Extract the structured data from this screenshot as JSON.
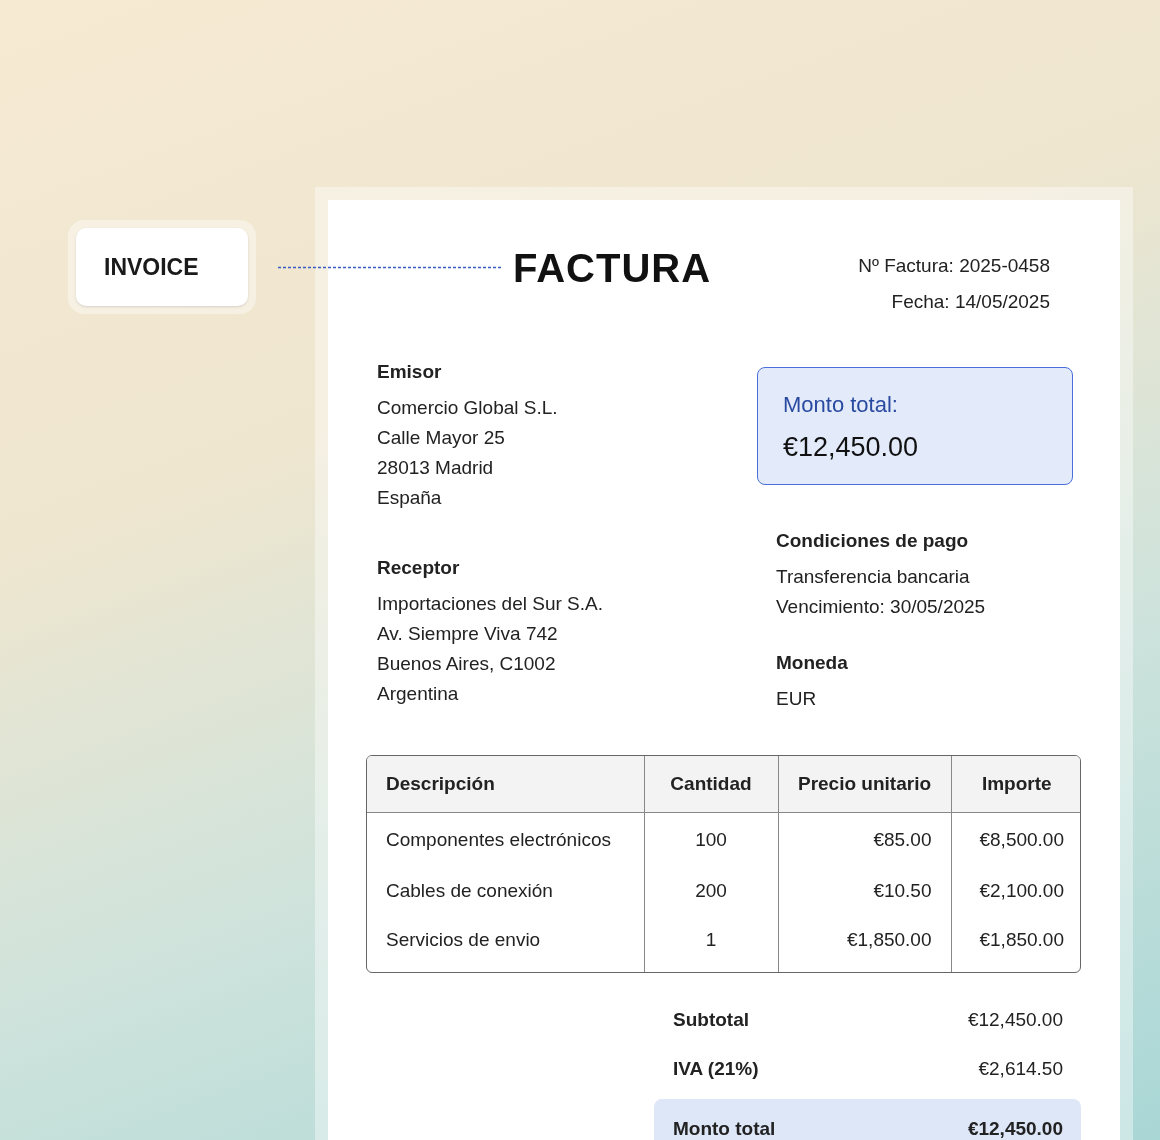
{
  "label": "INVOICE",
  "document": {
    "title": "FACTURA",
    "meta": [
      "Nº Factura: 2025-0458",
      "Fecha: 14/05/2025"
    ],
    "issuer": {
      "heading": "Emisor",
      "lines": [
        "Comercio Global S.L.",
        "Calle Mayor 25",
        "28013 Madrid",
        "España"
      ]
    },
    "recipient": {
      "heading": "Receptor",
      "lines": [
        "Importaciones del Sur S.A.",
        "Av. Siempre Viva 742",
        "Buenos Aires, C1002",
        "Argentina"
      ]
    },
    "total_box": {
      "label": "Monto total:",
      "amount": "€12,450.00"
    },
    "payment": {
      "heading": "Condiciones de pago",
      "lines": [
        "Transferencia bancaria",
        "Vencimiento: 30/05/2025"
      ]
    },
    "currency": {
      "heading": "Moneda",
      "value": "EUR"
    },
    "table": {
      "columns": [
        "Descripción",
        "Cantidad",
        "Precio unitario",
        "Importe"
      ],
      "rows": [
        [
          "Componentes electrónicos",
          "100",
          "€85.00",
          "€8,500.00"
        ],
        [
          "Cables de conexión",
          "200",
          "€10.50",
          "€2,100.00"
        ],
        [
          "Servicios de envio",
          "1",
          "€1,850.00",
          "€1,850.00"
        ]
      ]
    },
    "totals": [
      {
        "label": "Subtotal",
        "value": "€12,450.00",
        "highlight": false
      },
      {
        "label": "IVA (21%)",
        "value": "€2,614.50",
        "highlight": false
      },
      {
        "label": "Monto total",
        "value": "€12,450.00",
        "highlight": true
      }
    ]
  }
}
